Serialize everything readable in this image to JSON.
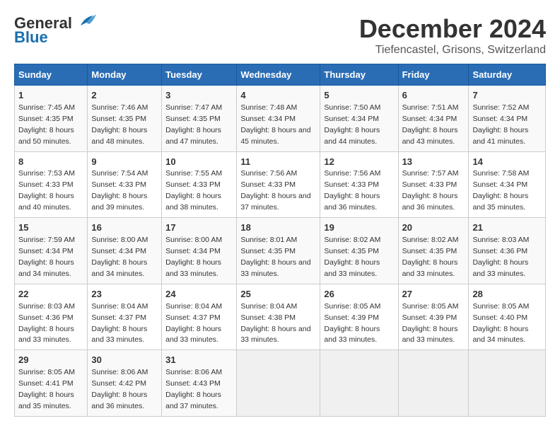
{
  "header": {
    "logo_general": "General",
    "logo_blue": "Blue",
    "title": "December 2024",
    "subtitle": "Tiefencastel, Grisons, Switzerland"
  },
  "weekdays": [
    "Sunday",
    "Monday",
    "Tuesday",
    "Wednesday",
    "Thursday",
    "Friday",
    "Saturday"
  ],
  "weeks": [
    [
      {
        "day": "1",
        "sunrise": "Sunrise: 7:45 AM",
        "sunset": "Sunset: 4:35 PM",
        "daylight": "Daylight: 8 hours and 50 minutes."
      },
      {
        "day": "2",
        "sunrise": "Sunrise: 7:46 AM",
        "sunset": "Sunset: 4:35 PM",
        "daylight": "Daylight: 8 hours and 48 minutes."
      },
      {
        "day": "3",
        "sunrise": "Sunrise: 7:47 AM",
        "sunset": "Sunset: 4:35 PM",
        "daylight": "Daylight: 8 hours and 47 minutes."
      },
      {
        "day": "4",
        "sunrise": "Sunrise: 7:48 AM",
        "sunset": "Sunset: 4:34 PM",
        "daylight": "Daylight: 8 hours and 45 minutes."
      },
      {
        "day": "5",
        "sunrise": "Sunrise: 7:50 AM",
        "sunset": "Sunset: 4:34 PM",
        "daylight": "Daylight: 8 hours and 44 minutes."
      },
      {
        "day": "6",
        "sunrise": "Sunrise: 7:51 AM",
        "sunset": "Sunset: 4:34 PM",
        "daylight": "Daylight: 8 hours and 43 minutes."
      },
      {
        "day": "7",
        "sunrise": "Sunrise: 7:52 AM",
        "sunset": "Sunset: 4:34 PM",
        "daylight": "Daylight: 8 hours and 41 minutes."
      }
    ],
    [
      {
        "day": "8",
        "sunrise": "Sunrise: 7:53 AM",
        "sunset": "Sunset: 4:33 PM",
        "daylight": "Daylight: 8 hours and 40 minutes."
      },
      {
        "day": "9",
        "sunrise": "Sunrise: 7:54 AM",
        "sunset": "Sunset: 4:33 PM",
        "daylight": "Daylight: 8 hours and 39 minutes."
      },
      {
        "day": "10",
        "sunrise": "Sunrise: 7:55 AM",
        "sunset": "Sunset: 4:33 PM",
        "daylight": "Daylight: 8 hours and 38 minutes."
      },
      {
        "day": "11",
        "sunrise": "Sunrise: 7:56 AM",
        "sunset": "Sunset: 4:33 PM",
        "daylight": "Daylight: 8 hours and 37 minutes."
      },
      {
        "day": "12",
        "sunrise": "Sunrise: 7:56 AM",
        "sunset": "Sunset: 4:33 PM",
        "daylight": "Daylight: 8 hours and 36 minutes."
      },
      {
        "day": "13",
        "sunrise": "Sunrise: 7:57 AM",
        "sunset": "Sunset: 4:33 PM",
        "daylight": "Daylight: 8 hours and 36 minutes."
      },
      {
        "day": "14",
        "sunrise": "Sunrise: 7:58 AM",
        "sunset": "Sunset: 4:34 PM",
        "daylight": "Daylight: 8 hours and 35 minutes."
      }
    ],
    [
      {
        "day": "15",
        "sunrise": "Sunrise: 7:59 AM",
        "sunset": "Sunset: 4:34 PM",
        "daylight": "Daylight: 8 hours and 34 minutes."
      },
      {
        "day": "16",
        "sunrise": "Sunrise: 8:00 AM",
        "sunset": "Sunset: 4:34 PM",
        "daylight": "Daylight: 8 hours and 34 minutes."
      },
      {
        "day": "17",
        "sunrise": "Sunrise: 8:00 AM",
        "sunset": "Sunset: 4:34 PM",
        "daylight": "Daylight: 8 hours and 33 minutes."
      },
      {
        "day": "18",
        "sunrise": "Sunrise: 8:01 AM",
        "sunset": "Sunset: 4:35 PM",
        "daylight": "Daylight: 8 hours and 33 minutes."
      },
      {
        "day": "19",
        "sunrise": "Sunrise: 8:02 AM",
        "sunset": "Sunset: 4:35 PM",
        "daylight": "Daylight: 8 hours and 33 minutes."
      },
      {
        "day": "20",
        "sunrise": "Sunrise: 8:02 AM",
        "sunset": "Sunset: 4:35 PM",
        "daylight": "Daylight: 8 hours and 33 minutes."
      },
      {
        "day": "21",
        "sunrise": "Sunrise: 8:03 AM",
        "sunset": "Sunset: 4:36 PM",
        "daylight": "Daylight: 8 hours and 33 minutes."
      }
    ],
    [
      {
        "day": "22",
        "sunrise": "Sunrise: 8:03 AM",
        "sunset": "Sunset: 4:36 PM",
        "daylight": "Daylight: 8 hours and 33 minutes."
      },
      {
        "day": "23",
        "sunrise": "Sunrise: 8:04 AM",
        "sunset": "Sunset: 4:37 PM",
        "daylight": "Daylight: 8 hours and 33 minutes."
      },
      {
        "day": "24",
        "sunrise": "Sunrise: 8:04 AM",
        "sunset": "Sunset: 4:37 PM",
        "daylight": "Daylight: 8 hours and 33 minutes."
      },
      {
        "day": "25",
        "sunrise": "Sunrise: 8:04 AM",
        "sunset": "Sunset: 4:38 PM",
        "daylight": "Daylight: 8 hours and 33 minutes."
      },
      {
        "day": "26",
        "sunrise": "Sunrise: 8:05 AM",
        "sunset": "Sunset: 4:39 PM",
        "daylight": "Daylight: 8 hours and 33 minutes."
      },
      {
        "day": "27",
        "sunrise": "Sunrise: 8:05 AM",
        "sunset": "Sunset: 4:39 PM",
        "daylight": "Daylight: 8 hours and 33 minutes."
      },
      {
        "day": "28",
        "sunrise": "Sunrise: 8:05 AM",
        "sunset": "Sunset: 4:40 PM",
        "daylight": "Daylight: 8 hours and 34 minutes."
      }
    ],
    [
      {
        "day": "29",
        "sunrise": "Sunrise: 8:05 AM",
        "sunset": "Sunset: 4:41 PM",
        "daylight": "Daylight: 8 hours and 35 minutes."
      },
      {
        "day": "30",
        "sunrise": "Sunrise: 8:06 AM",
        "sunset": "Sunset: 4:42 PM",
        "daylight": "Daylight: 8 hours and 36 minutes."
      },
      {
        "day": "31",
        "sunrise": "Sunrise: 8:06 AM",
        "sunset": "Sunset: 4:43 PM",
        "daylight": "Daylight: 8 hours and 37 minutes."
      },
      null,
      null,
      null,
      null
    ]
  ]
}
